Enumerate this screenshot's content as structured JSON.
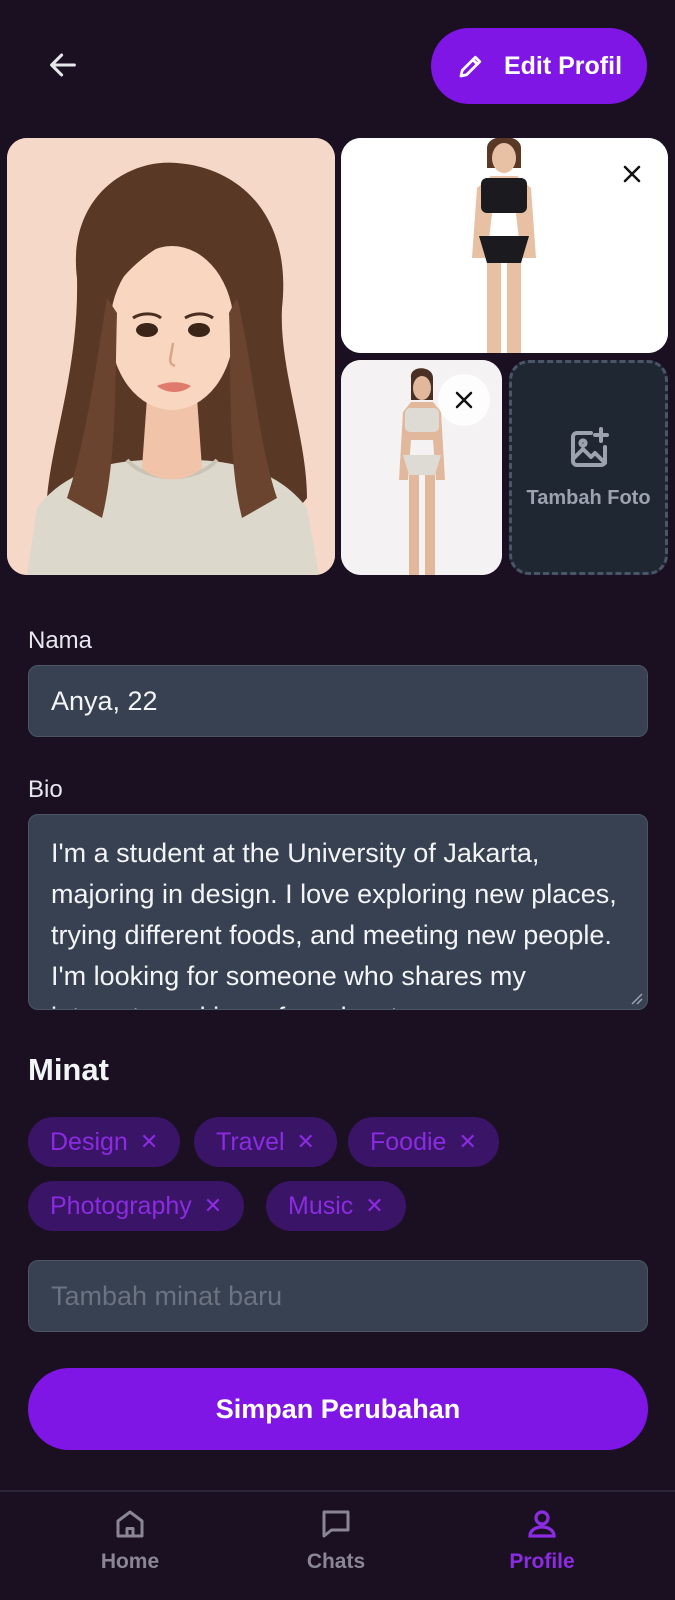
{
  "header": {
    "back_icon": "arrow-left-icon",
    "edit_button_label": "Edit Profil",
    "edit_icon": "pencil-icon"
  },
  "photos": {
    "add_photo_label": "Tambah Foto",
    "add_photo_icon": "add-photo-icon",
    "remove_icon": "close-icon"
  },
  "form": {
    "name_label": "Nama",
    "name_value": "Anya, 22",
    "bio_label": "Bio",
    "bio_value": "I'm a student at the University of Jakarta, majoring in design. I love exploring new places, trying different foods, and meeting new people. I'm looking for someone who shares my interests and is up for adventure."
  },
  "interests": {
    "title": "Minat",
    "tags": [
      "Design",
      "Travel",
      "Foodie",
      "Photography",
      "Music"
    ],
    "new_placeholder": "Tambah minat baru"
  },
  "save_button_label": "Simpan Perubahan",
  "nav": {
    "items": [
      {
        "label": "Home",
        "icon": "home-icon",
        "active": false
      },
      {
        "label": "Chats",
        "icon": "chat-icon",
        "active": false
      },
      {
        "label": "Profile",
        "icon": "user-icon",
        "active": true
      }
    ]
  },
  "colors": {
    "background": "#1a1022",
    "accent": "#7f16e6",
    "input_bg": "#374151",
    "tag_bg": "#3a1466",
    "tag_text": "#8b2be2"
  }
}
